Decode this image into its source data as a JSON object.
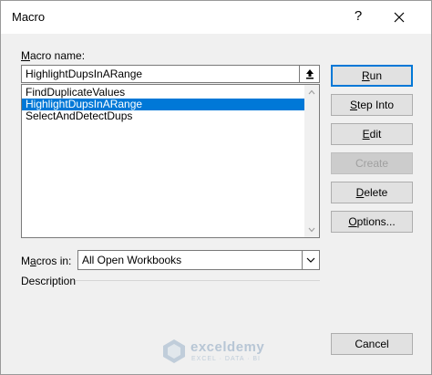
{
  "window": {
    "title": "Macro",
    "help_label": "?"
  },
  "form": {
    "macro_name_label": "Macro name:",
    "macro_name_accesskey": "M",
    "macro_name_rest": "acro name:",
    "macro_name_value": "HighlightDupsInARange",
    "macros": [
      {
        "label": "FindDuplicateValues",
        "selected": false
      },
      {
        "label": "HighlightDupsInARange",
        "selected": true
      },
      {
        "label": "SelectAndDetectDups",
        "selected": false
      }
    ],
    "macros_in_label": "Macros in:",
    "macros_in_pre": "M",
    "macros_in_accesskey": "a",
    "macros_in_rest": "cros in:",
    "macros_in_value": "All Open Workbooks",
    "description_label": "Description"
  },
  "buttons": {
    "run": {
      "accesskey": "R",
      "rest": "un",
      "enabled": true
    },
    "step_into": {
      "accesskey": "S",
      "rest": "tep Into",
      "enabled": true
    },
    "edit": {
      "accesskey": "E",
      "rest": "dit",
      "enabled": true
    },
    "create": {
      "label": "Create",
      "enabled": false
    },
    "delete": {
      "accesskey": "D",
      "rest": "elete",
      "enabled": true
    },
    "options": {
      "accesskey": "O",
      "rest": "ptions...",
      "enabled": true
    },
    "cancel": {
      "label": "Cancel",
      "enabled": true
    }
  },
  "watermark": {
    "brand": "exceldemy",
    "tagline": "EXCEL · DATA · BI"
  },
  "colors": {
    "selection": "#0078d7",
    "dialog_bg": "#f0f0f0",
    "default_button_border": "#0078d7"
  }
}
